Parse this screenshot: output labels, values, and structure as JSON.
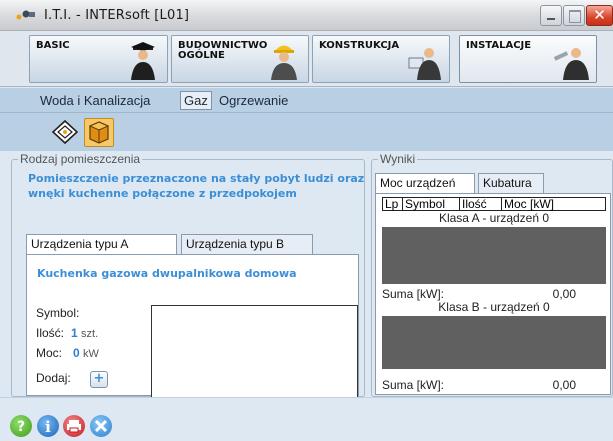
{
  "window": {
    "title": "I.T.I. - INTERsoft [L01]",
    "close_glyph": "✕"
  },
  "modules": [
    {
      "label": "BASIC",
      "icon": "graduate-figure-icon"
    },
    {
      "label": "BUDOWNICTWO\nOGÓLNE",
      "icon": "builder-figure-icon"
    },
    {
      "label": "KONSTRUKCJA",
      "icon": "engineer-figure-icon"
    },
    {
      "label": "INSTALACJE",
      "icon": "installer-figure-icon",
      "active": true
    }
  ],
  "subnav": {
    "items": [
      "Woda i Kanalizacja",
      "Gaz",
      "Ogrzewanie"
    ],
    "selected": "Gaz"
  },
  "toolbar": {
    "icons": [
      "gas-network-icon",
      "gas-device-icon"
    ],
    "active_icon": "gas-device-icon"
  },
  "rooms": {
    "legend": "Rodzaj pomieszczenia",
    "description": "Pomieszczenie przeznaczone na stały pobyt ludzi oraz wnęki kuchenne połączone z przedpokojem",
    "tabs": [
      "Urządzenia typu A",
      "Urządzenia typu B"
    ],
    "active_tab": "Urządzenia typu A",
    "device_name": "Kuchenka gazowa dwupalnikowa domowa",
    "symbol_label": "Symbol:",
    "ilosc_label": "Ilość:",
    "ilosc_value": "1",
    "ilosc_unit": "szt.",
    "moc_label": "Moc:",
    "moc_value": "0",
    "moc_unit": "kW",
    "dodaj_label": "Dodaj:",
    "dodaj_glyph": "+"
  },
  "results": {
    "legend": "Wyniki",
    "tabs": [
      "Moc urządzeń",
      "Kubatura"
    ],
    "active_tab": "Moc urządzeń",
    "columns": [
      "Lp",
      "Symbol",
      "Ilość",
      "Moc [kW]"
    ],
    "klasa_a": "Klasa A - urządzeń 0",
    "suma_a_label": "Suma [kW]:",
    "suma_a_value": "0,00",
    "klasa_b": "Klasa B - urządzeń 0",
    "suma_b_label": "Suma [kW]:",
    "suma_b_value": "0,00"
  },
  "footer": {
    "icons": [
      "help-icon",
      "info-icon",
      "print-icon",
      "tools-icon"
    ],
    "colors": {
      "help": "#4caf2a",
      "info": "#2a7fd4",
      "print": "#d2282e",
      "tools": "#3a8fd6"
    }
  },
  "colors": {
    "accent_text": "#3c8fd6",
    "subnav_bg": "#b9cfe4",
    "active_tool": "#f5c96a",
    "result_box": "#606060"
  }
}
